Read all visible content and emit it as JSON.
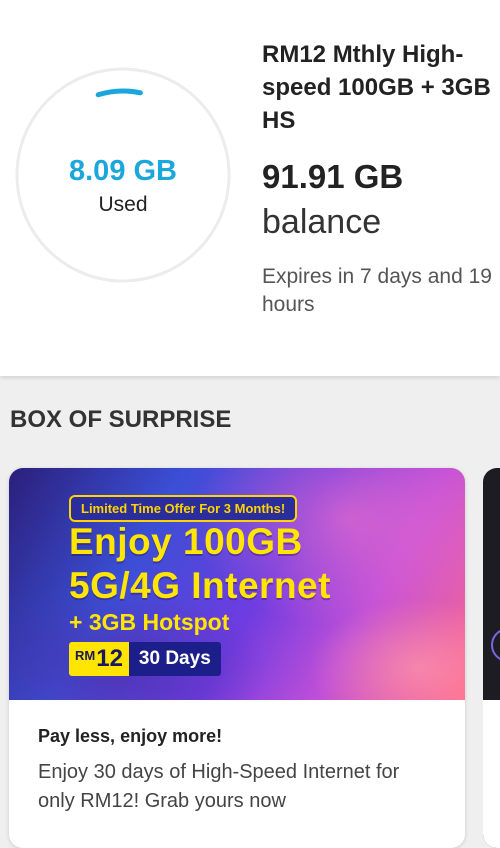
{
  "usage": {
    "used_value": "8.09 GB",
    "used_label": "Used",
    "used_fraction": 0.081,
    "plan_name": "RM12 Mthly High-speed 100GB + 3GB HS",
    "balance_value": "91.91 GB",
    "balance_label": "balance",
    "expiry": "Expires in 7 days and 19 hours",
    "accent_color": "#1ba7dc"
  },
  "section": {
    "title": "BOX OF SURPRISE"
  },
  "promo": {
    "offer_pill": "Limited Time Offer For 3 Months!",
    "headline_1": "Enjoy 100GB",
    "headline_2": "5G/4G Internet",
    "hotspot": "+ 3GB Hotspot",
    "price_currency": "RM",
    "price_amount": "12",
    "price_days": "30 Days",
    "title": "Pay less, enjoy more!",
    "description": "Enjoy 30 days of High-Speed Internet for only RM12! Grab yours now"
  }
}
